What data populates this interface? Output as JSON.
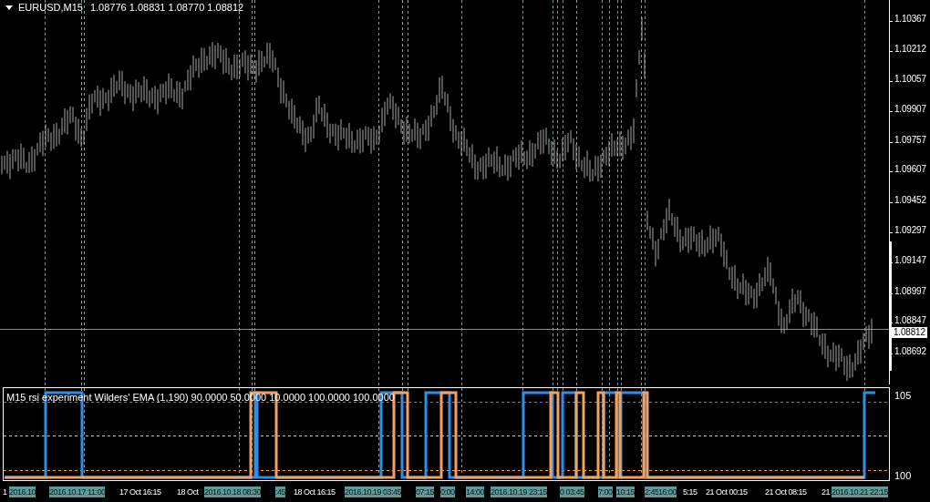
{
  "chart": {
    "symbol": "EURUSD,M15",
    "ohlc": "1.08776 1.08831 1.08770 1.08812",
    "current_price": "1.08812",
    "price_labels": [
      "1.10367",
      "1.10212",
      "1.10057",
      "1.09907",
      "1.09757",
      "1.09607",
      "1.09452",
      "1.09297",
      "1.09147",
      "1.08997",
      "1.08847",
      "1.08692"
    ]
  },
  "indicator": {
    "label": "M15 rsi experiment Wilders' EMA (1,190) 90.0000 50.0000 10.0000 100.0000 100.0000",
    "scale_labels": [
      "105",
      "100"
    ]
  },
  "time_axis": {
    "labels": [
      {
        "text": "1",
        "highlighted": false
      },
      {
        "text": "2016.10",
        "highlighted": true
      },
      {
        "text": "2016.10.17 11:00",
        "highlighted": true
      },
      {
        "text": "17 Oct 16:15",
        "highlighted": false
      },
      {
        "text": "18 Oct",
        "highlighted": false
      },
      {
        "text": "2016.10.18 08:30",
        "highlighted": true
      },
      {
        "text": ":45",
        "highlighted": true
      },
      {
        "text": "18 Oct 16:15",
        "highlighted": false
      },
      {
        "text": "2016.10.19 03:45",
        "highlighted": true
      },
      {
        "text": "07:15",
        "highlighted": true
      },
      {
        "text": "0:00",
        "highlighted": true
      },
      {
        "text": "14:00",
        "highlighted": true
      },
      {
        "text": "2016.10.19 23:15",
        "highlighted": true
      },
      {
        "text": "0 03:45",
        "highlighted": true
      },
      {
        "text": "7:00",
        "highlighted": true
      },
      {
        "text": "10:15",
        "highlighted": true
      },
      {
        "text": "2:45",
        "highlighted": true
      },
      {
        "text": "16:00",
        "highlighted": true
      },
      {
        "text": "5:15",
        "highlighted": false
      },
      {
        "text": "21 Oct 00:15",
        "highlighted": false
      },
      {
        "text": "21 Oct 08:15",
        "highlighted": false
      },
      {
        "text": "21",
        "highlighted": false
      },
      {
        "text": "2016.10.21 22:15",
        "highlighted": true
      }
    ]
  }
}
